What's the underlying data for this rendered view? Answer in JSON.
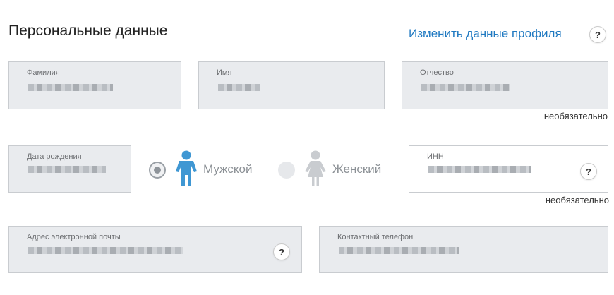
{
  "header": {
    "title": "Персональные данные",
    "edit_link": "Изменить данные профиля",
    "help": "?"
  },
  "fields": {
    "last_name": {
      "label": "Фамилия"
    },
    "first_name": {
      "label": "Имя"
    },
    "middle_name": {
      "label": "Отчество",
      "note": "необязательно"
    },
    "birth_date": {
      "label": "Дата рождения"
    },
    "inn": {
      "label": "ИНН",
      "note": "необязательно",
      "help": "?"
    },
    "email": {
      "label": "Адрес электронной почты",
      "help": "?"
    },
    "phone": {
      "label": "Контактный телефон"
    }
  },
  "gender": {
    "options": [
      {
        "label": "Мужской",
        "selected": true
      },
      {
        "label": "Женский",
        "selected": false
      }
    ]
  },
  "colors": {
    "accent": "#1f79c1",
    "male_icon": "#3f97d3",
    "female_icon": "#c9ccd0",
    "field_bg": "#e9ebee"
  },
  "icons": [
    "question-icon",
    "male-figure-icon",
    "female-figure-icon"
  ]
}
